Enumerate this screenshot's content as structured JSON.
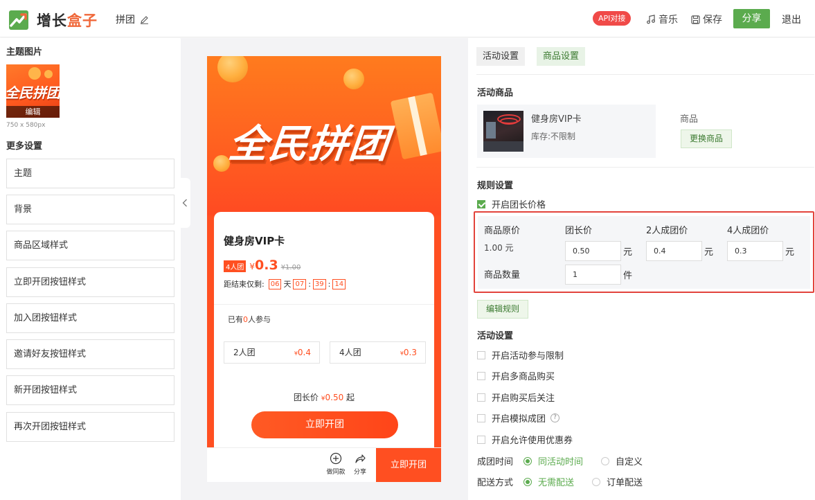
{
  "header": {
    "brand_a": "增长",
    "brand_b": "盒子",
    "page_title": "拼团",
    "api_badge": "API对接",
    "music_label": "音乐",
    "save_label": "保存",
    "share_label": "分享",
    "exit_label": "退出",
    "colors": {
      "accent_green": "#5bab4e",
      "badge_red": "#f04a48",
      "brand_orange": "#f0683a"
    }
  },
  "left": {
    "theme_image_title": "主题图片",
    "thumb_text": "全民拼团",
    "thumb_edit": "编辑",
    "size_note": "750 x 580px",
    "more_settings_title": "更多设置",
    "menu": [
      "主题",
      "背景",
      "商品区域样式",
      "立即开团按钮样式",
      "加入团按钮样式",
      "邀请好友按钮样式",
      "新开团按钮样式",
      "再次开团按钮样式"
    ]
  },
  "preview": {
    "banner_title": "全民拼团",
    "product_name": "健身房VIP卡",
    "group_tag": "4人团",
    "yen": "¥",
    "price": "0.3",
    "original_price": "¥1.00",
    "countdown_label": "距结束仅剩:",
    "cd_days": "06",
    "cd_day_unit": "天",
    "cd_hours": "07",
    "cd_minutes": "39",
    "cd_seconds": "14",
    "joined_prefix": "已有",
    "joined_count": "0",
    "joined_suffix": "人参与",
    "options": [
      {
        "label": "2人团",
        "yen": "¥",
        "price": "0.4"
      },
      {
        "label": "4人团",
        "yen": "¥",
        "price": "0.3"
      }
    ],
    "leader_label": "团长价",
    "leader_yen": "¥",
    "leader_price": "0.50",
    "leader_suffix": "起",
    "open_button": "立即开团",
    "bottom_same": "做同款",
    "bottom_share": "分享",
    "bottom_open": "立即开团",
    "colors": {
      "theme": "#ff4f21"
    }
  },
  "right": {
    "tabs": [
      "活动设置",
      "商品设置"
    ],
    "active_tab": "商品设置",
    "activity_goods_title": "活动商品",
    "product_name": "健身房VIP卡",
    "product_stock": "库存:不限制",
    "goods_label": "商品",
    "change_goods_button": "更换商品",
    "rule_settings_title": "规则设置",
    "leader_price_checkbox": "开启团长价格",
    "leader_price_checked": true,
    "rule": {
      "headers": [
        "商品原价",
        "团长价",
        "2人成团价",
        "4人成团价"
      ],
      "original_price": "1.00 元",
      "leader_price": "0.50",
      "price_2": "0.4",
      "price_4": "0.3",
      "unit_yuan": "元",
      "quantity_label": "商品数量",
      "quantity": "1",
      "unit_piece": "件"
    },
    "edit_rule_button": "编辑规则",
    "activity_settings_title": "活动设置",
    "checkboxes": [
      "开启活动参与限制",
      "开启多商品购买",
      "开启购买后关注",
      "开启模拟成团",
      "开启允许使用优惠券"
    ],
    "help_mark": "?",
    "group_time_label": "成团时间",
    "group_time_options": [
      "同活动时间",
      "自定义"
    ],
    "delivery_label": "配送方式",
    "delivery_options": [
      "无需配送",
      "订单配送"
    ]
  }
}
